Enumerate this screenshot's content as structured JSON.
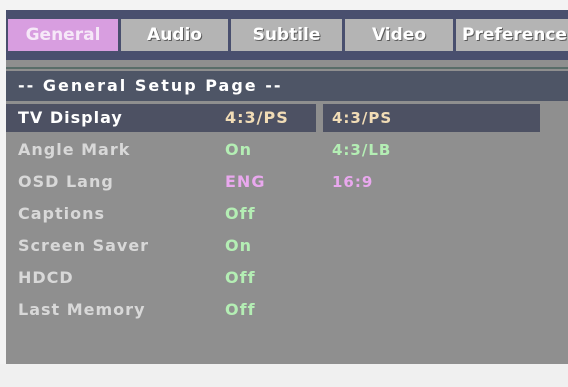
{
  "tabs": [
    {
      "label": "General",
      "active": true
    },
    {
      "label": "Audio",
      "active": false
    },
    {
      "label": "Subtile",
      "active": false
    },
    {
      "label": "Video",
      "active": false
    },
    {
      "label": "Preference",
      "active": false
    }
  ],
  "page_title": "-- General Setup Page --",
  "settings": [
    {
      "label": "TV Display",
      "value": "4:3/PS",
      "selected": true
    },
    {
      "label": "Angle Mark",
      "value": "On"
    },
    {
      "label": "OSD Lang",
      "value": "ENG"
    },
    {
      "label": "Captions",
      "value": "Off"
    },
    {
      "label": "Screen Saver",
      "value": "On"
    },
    {
      "label": "HDCD",
      "value": "Off"
    },
    {
      "label": "Last Memory",
      "value": "Off"
    }
  ],
  "options": [
    {
      "label": "4:3/PS",
      "selected": true
    },
    {
      "label": "4:3/LB"
    },
    {
      "label": "16:9"
    }
  ],
  "colors": {
    "tab_active": "#d89ee0",
    "tab_inactive": "#b4b4b4",
    "tabbar_bg": "#494f6e",
    "menu_bg": "#8f8f8f",
    "highlight_bg": "#4d5163",
    "value_green": "#b4eeb4",
    "value_pink": "#e9a8ee",
    "value_selected": "#f1dcb6"
  }
}
